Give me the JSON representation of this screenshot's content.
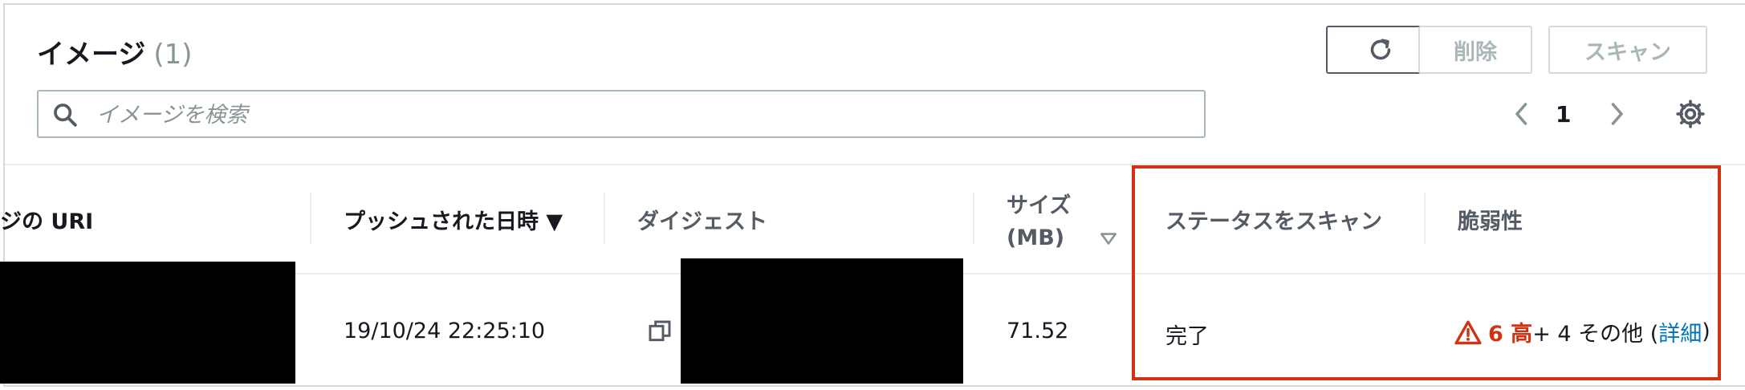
{
  "header": {
    "title": "イメージ",
    "count": "(1)",
    "refresh_icon": "refresh-icon",
    "delete_label": "削除",
    "scan_label": "スキャン"
  },
  "search": {
    "placeholder": "イメージを検索",
    "icon": "search-icon"
  },
  "pagination": {
    "current_page": "1",
    "prev_icon": "chevron-left-icon",
    "next_icon": "chevron-right-icon"
  },
  "settings_icon": "gear-icon",
  "table": {
    "columns": {
      "uri": "ジの URI",
      "pushed_at": "プッシュされた日時 ▼",
      "digest": "ダイジェスト",
      "size_line1": "サイズ",
      "size_line2": "(MB)",
      "scan_status": "ステータスをスキャン",
      "vulnerabilities": "脆弱性"
    },
    "rows": [
      {
        "pushed_at": "19/10/24 22:25:10",
        "size": "71.52",
        "scan_status": "完了",
        "vuln_high": "6 高",
        "vuln_rest": " + 4 その他 (",
        "vuln_link": "詳細",
        "vuln_close": ")"
      }
    ]
  },
  "colors": {
    "highlight": "#d13212",
    "link": "#0073bb",
    "warning": "#d13212"
  }
}
